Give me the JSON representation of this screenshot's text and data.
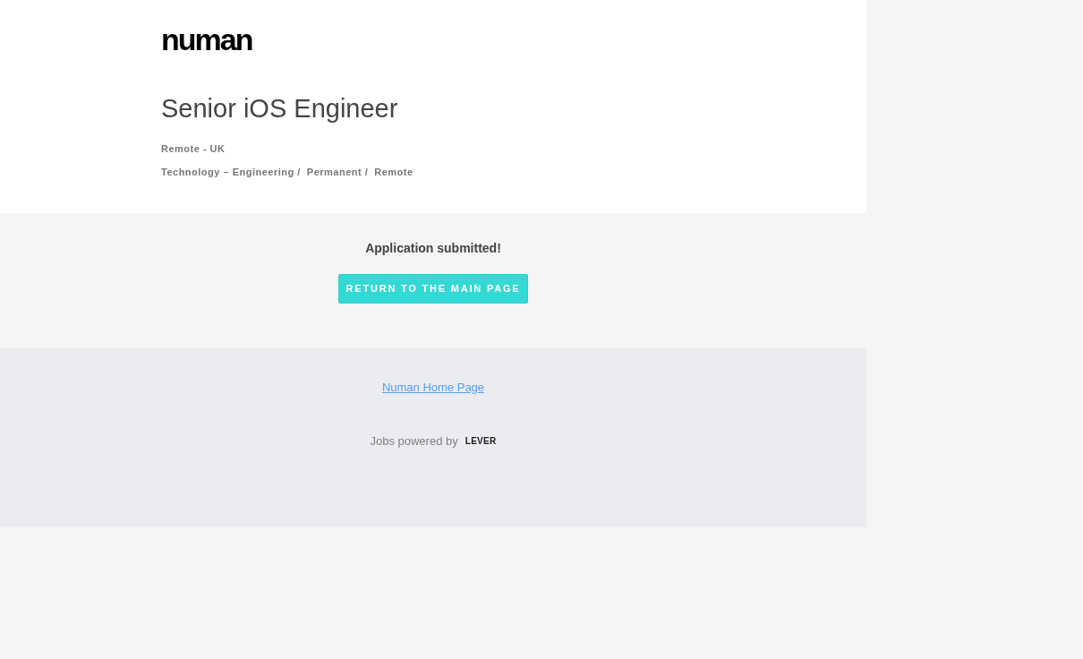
{
  "logo": "numan",
  "job": {
    "title": "Senior iOS Engineer",
    "location": "Remote - UK",
    "categories": [
      "Technology – Engineering /",
      "Permanent /",
      "Remote"
    ]
  },
  "confirmation": {
    "message": "Application submitted!",
    "button": "RETURN TO THE MAIN PAGE"
  },
  "footer": {
    "home_link": "Numan Home Page",
    "powered_by": "Jobs powered by",
    "brand": "LEVER"
  }
}
